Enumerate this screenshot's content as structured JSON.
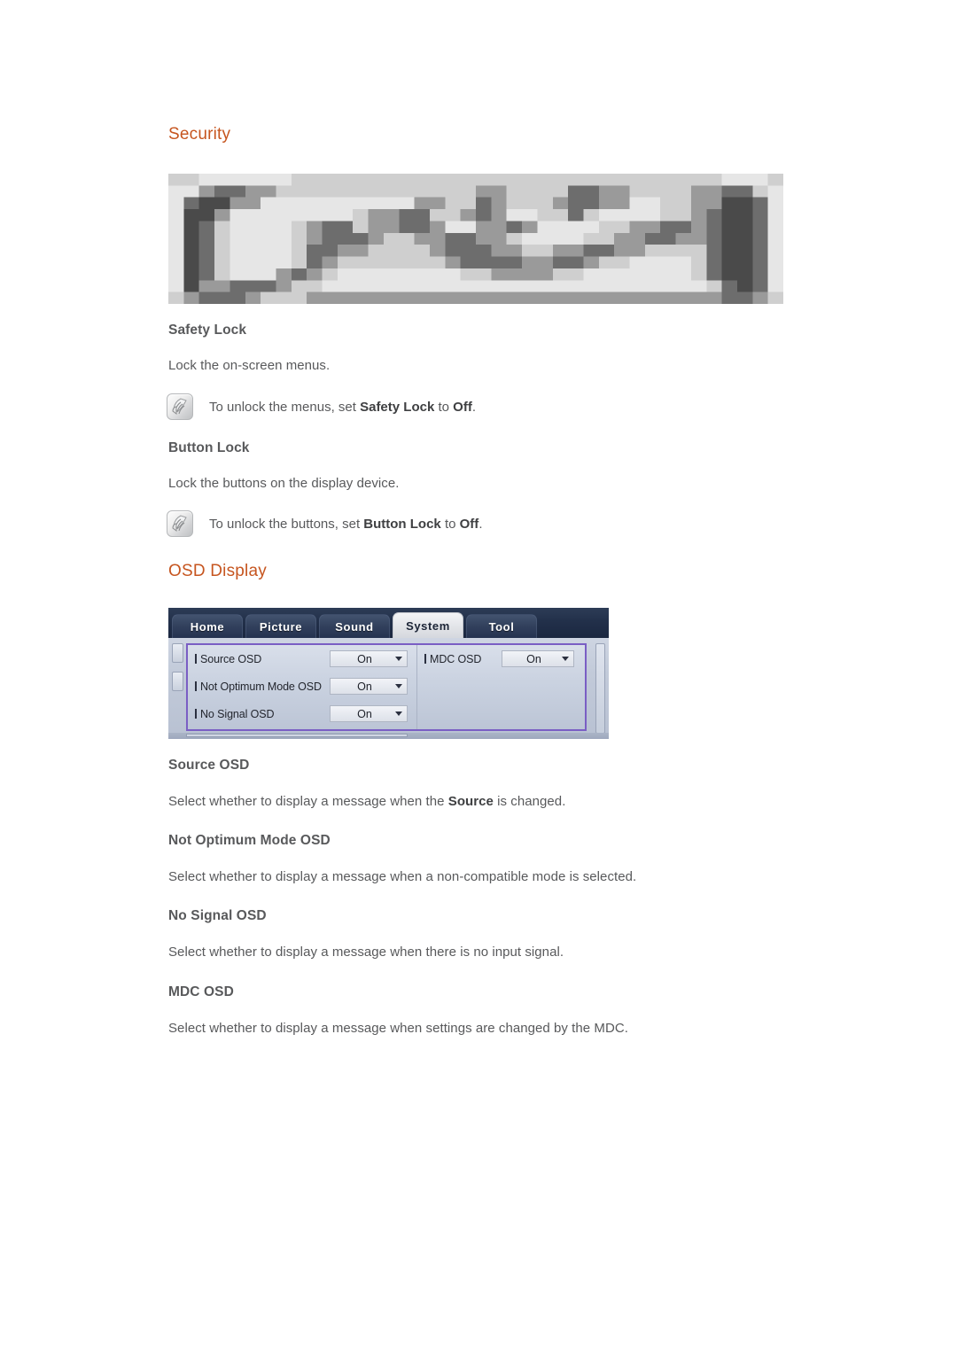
{
  "sections": {
    "security": {
      "heading": "Security",
      "safety_lock": {
        "title": "Safety Lock",
        "description": "Lock the on-screen menus.",
        "note_prefix": "To unlock the menus, set ",
        "note_bold1": "Safety Lock",
        "note_mid": " to ",
        "note_bold2": "Off",
        "note_suffix": "."
      },
      "button_lock": {
        "title": "Button Lock",
        "description": "Lock the buttons on the display device.",
        "note_prefix": "To unlock the buttons, set ",
        "note_bold1": "Button Lock",
        "note_mid": " to ",
        "note_bold2": "Off",
        "note_suffix": "."
      }
    },
    "osd_display": {
      "heading": "OSD Display",
      "items": [
        {
          "title": "Source OSD",
          "desc_prefix": "Select whether to display a message when the ",
          "desc_bold": "Source",
          "desc_suffix": " is changed."
        },
        {
          "title": "Not Optimum Mode OSD",
          "desc_prefix": "Select whether to display a message when a non-compatible mode is selected.",
          "desc_bold": "",
          "desc_suffix": ""
        },
        {
          "title": "No Signal OSD",
          "desc_prefix": "Select whether to display a message when there is no input signal.",
          "desc_bold": "",
          "desc_suffix": ""
        },
        {
          "title": "MDC OSD",
          "desc_prefix": "Select whether to display a message when settings are changed by the MDC.",
          "desc_bold": "",
          "desc_suffix": ""
        }
      ]
    }
  },
  "osd_menu": {
    "tabs": [
      {
        "label": "Home",
        "active": false
      },
      {
        "label": "Picture",
        "active": false
      },
      {
        "label": "Sound",
        "active": false
      },
      {
        "label": "System",
        "active": true
      },
      {
        "label": "Tool",
        "active": false
      }
    ],
    "left_column": [
      {
        "label": "Source OSD",
        "value": "On"
      },
      {
        "label": "Not Optimum Mode OSD",
        "value": "On"
      },
      {
        "label": "No Signal OSD",
        "value": "On"
      }
    ],
    "right_column": [
      {
        "label": "MDC OSD",
        "value": "On"
      }
    ]
  },
  "icons": {
    "note": "note-hand-icon",
    "dropdown_arrow": "chevron-down-icon"
  },
  "colors": {
    "heading_orange": "#c6551f",
    "body_gray": "#58595b",
    "osd_tab_bar": "#22304a",
    "osd_panel_border": "#7a5ec4",
    "osd_body": "#c2cad9"
  },
  "corrupted_image": {
    "alt": "pixelated OSD Security menu screenshot"
  }
}
